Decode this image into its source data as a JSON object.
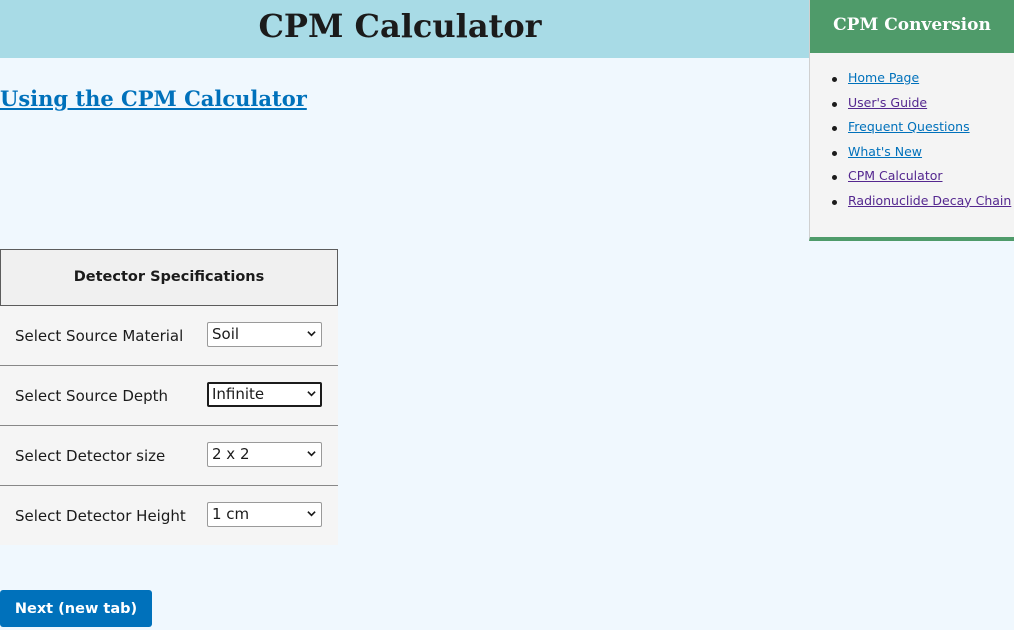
{
  "header": {
    "title": "CPM Calculator"
  },
  "main": {
    "using_link": "Using the CPM Calculator",
    "spec_table": {
      "header": "Detector Specifications",
      "rows": [
        {
          "label": "Select Source Material",
          "value": "Soil"
        },
        {
          "label": "Select Source Depth",
          "value": "Infinite"
        },
        {
          "label": "Select Detector size",
          "value": "2 x 2"
        },
        {
          "label": "Select Detector Height",
          "value": "1 cm"
        }
      ]
    },
    "next_button": "Next (new tab)"
  },
  "sidebar": {
    "title": "CPM Conversion",
    "items": [
      {
        "label": "Home Page",
        "state": "link"
      },
      {
        "label": "User's Guide",
        "state": "visited"
      },
      {
        "label": "Frequent Questions",
        "state": "link"
      },
      {
        "label": "What's New",
        "state": "link"
      },
      {
        "label": "CPM Calculator",
        "state": "visited"
      },
      {
        "label": "Radionuclide Decay Chain",
        "state": "visited"
      }
    ]
  },
  "colors": {
    "header_bg": "#a8dbe6",
    "sidebar_header_bg": "#4f9b6a",
    "link": "#0071bb",
    "visited_link": "#54278f",
    "button_bg": "#0071bb",
    "page_bg": "#f0f8fe"
  },
  "icons": {
    "select_arrow": "chevron-down-icon",
    "list_bullet": "bullet-icon"
  }
}
